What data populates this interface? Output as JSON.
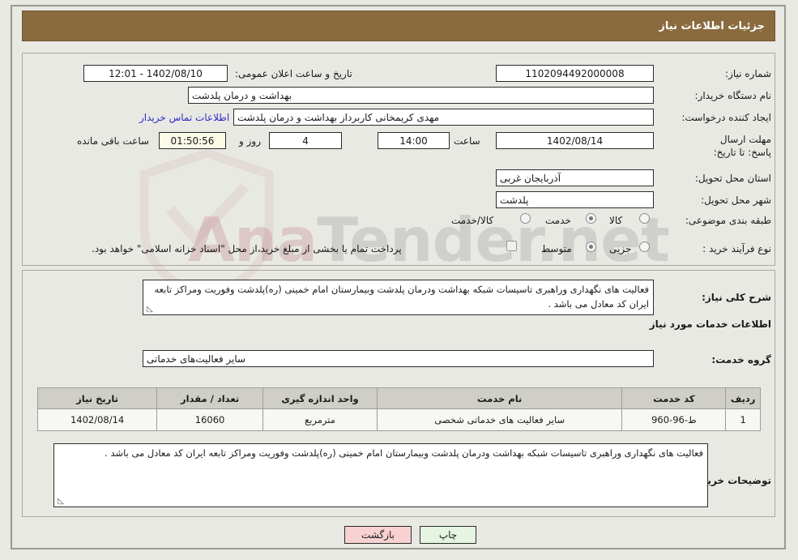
{
  "header": {
    "title": "جزئیات اطلاعات نیاز"
  },
  "top_form": {
    "need_number_label": "شماره نیاز:",
    "need_number_value": "1102094492000008",
    "announce_label": "تاریخ و ساعت اعلان عمومی:",
    "announce_value": "1402/08/10 - 12:01",
    "buyer_org_label": "نام دستگاه خریدار:",
    "buyer_org_value": "بهداشت و درمان پلدشت",
    "creator_label": "ایجاد کننده درخواست:",
    "creator_value": "مهدی کریمخانی کاربرداز بهداشت و درمان پلدشت",
    "contact_link": "اطلاعات تماس خریدار",
    "deadline_label": "مهلت ارسال پاسخ: تا تاریخ:",
    "deadline_date": "1402/08/14",
    "hour_label": "ساعت",
    "hour_value": "14:00",
    "days_value": "4",
    "days_label": "روز و",
    "remaining_value": "01:50:56",
    "remaining_label": "ساعت باقی مانده",
    "province_label": "استان محل تحویل:",
    "province_value": "آذربایجان غربی",
    "city_label": "شهر محل تحویل:",
    "city_value": "پلدشت",
    "category_label": "طبقه بندی موضوعی:",
    "category_options": [
      {
        "label": "کالا",
        "selected": false
      },
      {
        "label": "خدمت",
        "selected": true
      },
      {
        "label": "کالا/خدمت",
        "selected": false
      }
    ],
    "process_label": "نوع فرآیند خرید :",
    "process_options": [
      {
        "label": "جزیی",
        "selected": false
      },
      {
        "label": "متوسط",
        "selected": true
      }
    ],
    "treasury_checkbox_label": "پرداخت تمام یا بخشی از مبلغ خرید،از محل \"اسناد خزانه اسلامی\" خواهد بود.",
    "treasury_checked": false
  },
  "description": {
    "label": "شرح کلی نیاز:",
    "value": "فعالیت های نگهداری وراهبری تاسیسات شبکه بهداشت ودرمان پلدشت وبیمارستان امام خمینی (ره)پلدشت وفوریت ومراکز تابعه ایران کد معادل می باشد ."
  },
  "services_section": {
    "heading": "اطلاعات خدمات مورد نیاز",
    "group_label": "گروه خدمت:",
    "group_value": "سایر فعالیت‌های خدماتی"
  },
  "table": {
    "headers": [
      "ردیف",
      "کد خدمت",
      "نام خدمت",
      "واحد اندازه گیری",
      "تعداد / مقدار",
      "تاریخ نیاز"
    ],
    "rows": [
      {
        "row_no": "1",
        "service_code": "ط-96-960",
        "service_name": "سایر فعالیت های خدماتی شخصی",
        "unit": "مترمربع",
        "quantity": "16060",
        "need_date": "1402/08/14"
      }
    ]
  },
  "buyer_notes": {
    "label": "توضیحات خریدار:",
    "value": "فعالیت های نگهداری وراهبری تاسیسات شبکه بهداشت ودرمان پلدشت وبیمارستان امام خمینی (ره)پلدشت وفوریت ومراکز تابعه ایران کد معادل می باشد ."
  },
  "footer": {
    "print_label": "چاپ",
    "back_label": "بازگشت"
  },
  "watermark": {
    "text_left": "Ana",
    "text_right": "Tender.net"
  },
  "colors": {
    "header_bg": "#8a6b3e",
    "page_bg": "#e9e9e4",
    "link": "#2b2bc8",
    "print_btn": "#e5f5e2",
    "back_btn": "#f8d2d2",
    "table_header_bg": "#cfcfc8"
  }
}
